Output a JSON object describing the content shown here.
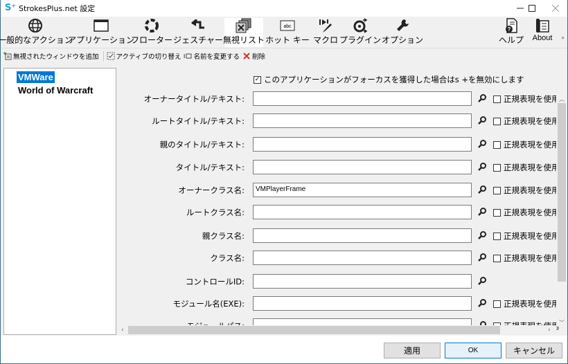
{
  "window": {
    "title": "StrokesPlus.net 設定",
    "minimize": "—",
    "maximize": "☐",
    "close": "✕"
  },
  "ribbon": {
    "items": [
      {
        "label": "一般的なアクション",
        "icon": "globe-icon"
      },
      {
        "label": "アプリケーション",
        "icon": "window-icon"
      },
      {
        "label": "フローター",
        "icon": "floater-circle-icon"
      },
      {
        "label": "ジェスチャー",
        "icon": "gesture-arrow-icon"
      },
      {
        "label": "無視リスト",
        "icon": "ignore-list-icon",
        "active": true
      },
      {
        "label": "ホット キー",
        "icon": "hotkey-abc-icon"
      },
      {
        "label": "マクロ",
        "icon": "macro-icon"
      },
      {
        "label": "プラグイン",
        "icon": "plugin-icon"
      },
      {
        "label": "オプション",
        "icon": "wrench-icon"
      },
      {
        "label": "ヘルプ",
        "icon": "help-icon"
      },
      {
        "label": "About",
        "icon": "about-icon"
      }
    ],
    "overflow": "»"
  },
  "toolbar": {
    "add": "無視されたウィンドウを追加",
    "toggle": "アクティブの切り替え",
    "rename": "名前を変更する",
    "delete": "削除"
  },
  "list": {
    "items": [
      {
        "label": "VMWare",
        "selected": true
      },
      {
        "label": "World of Warcraft",
        "selected": false
      }
    ]
  },
  "form": {
    "focus_checkbox": {
      "checked": true,
      "label": "このアプリケーションがフォーカスを獲得した場合はs +を無効にします"
    },
    "regex_label": "正規表現を使用",
    "fields": [
      {
        "label": "オーナータイトル/テキスト:",
        "value": "",
        "regex": true,
        "regex_checked": false
      },
      {
        "label": "ルートタイトル/テキスト:",
        "value": "",
        "regex": true,
        "regex_checked": false
      },
      {
        "label": "親のタイトル/テキスト:",
        "value": "",
        "regex": true,
        "regex_checked": false
      },
      {
        "label": "タイトル/テキスト:",
        "value": "",
        "regex": true,
        "regex_checked": false
      },
      {
        "label": "オーナークラス名:",
        "value": "VMPlayerFrame",
        "regex": true,
        "regex_checked": false
      },
      {
        "label": "ルートクラス名:",
        "value": "",
        "regex": true,
        "regex_checked": false
      },
      {
        "label": "親クラス名:",
        "value": "",
        "regex": true,
        "regex_checked": false
      },
      {
        "label": "クラス名:",
        "value": "",
        "regex": true,
        "regex_checked": false
      },
      {
        "label": "コントロールID:",
        "value": "",
        "regex": false,
        "regex_checked": false
      },
      {
        "label": "モジュール名(EXE):",
        "value": "",
        "regex": true,
        "regex_checked": false
      },
      {
        "label": "モジュールパス:",
        "value": "",
        "regex": true,
        "regex_checked": false
      }
    ]
  },
  "buttons": {
    "apply": "適用",
    "ok": "OK",
    "cancel": "キャンセル"
  },
  "colors": {
    "accent": "#0078d7",
    "app_icon": "#1aa3d9",
    "delete_red": "#d0312d"
  }
}
